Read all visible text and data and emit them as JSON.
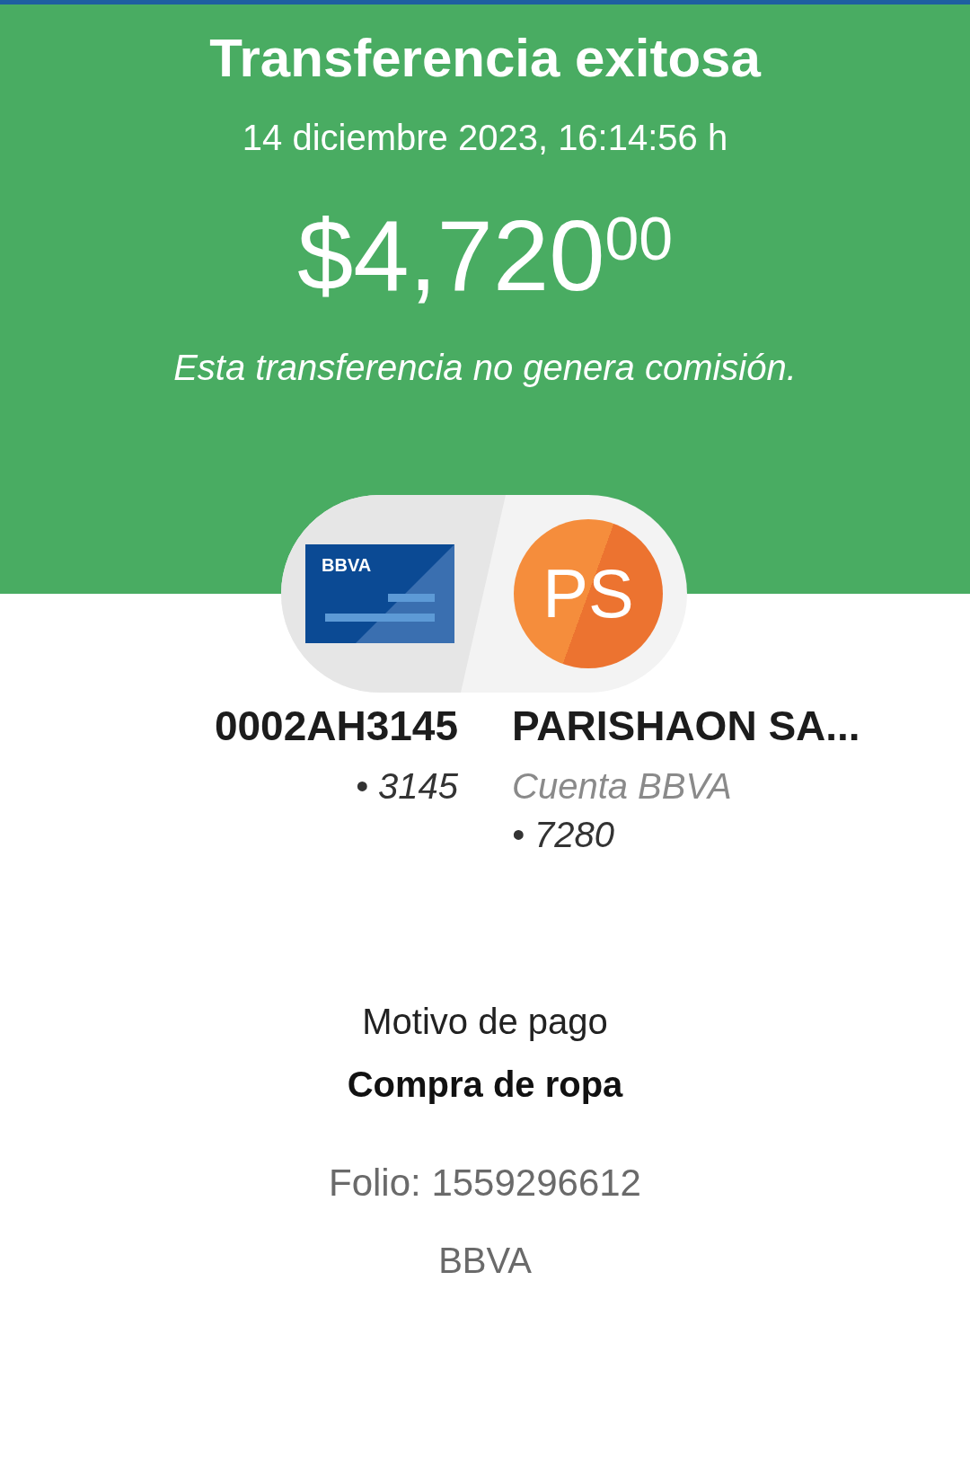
{
  "title": "Transferencia exitosa",
  "datetime": "14 diciembre 2023, 16:14:56 h",
  "amount": {
    "whole": "$4,720",
    "cents": "00"
  },
  "note": "Esta transferencia no genera comisión.",
  "origin": {
    "card_label": "BBVA",
    "name": "0002AH3145",
    "account": "• 3145"
  },
  "destination": {
    "initials": "PS",
    "name": "PARISHAON SA...",
    "bank": "Cuenta BBVA",
    "account": "• 7280"
  },
  "reason": {
    "label": "Motivo de pago",
    "value": "Compra de ropa"
  },
  "folio": "Folio: 1559296612",
  "footer": "BBVA"
}
